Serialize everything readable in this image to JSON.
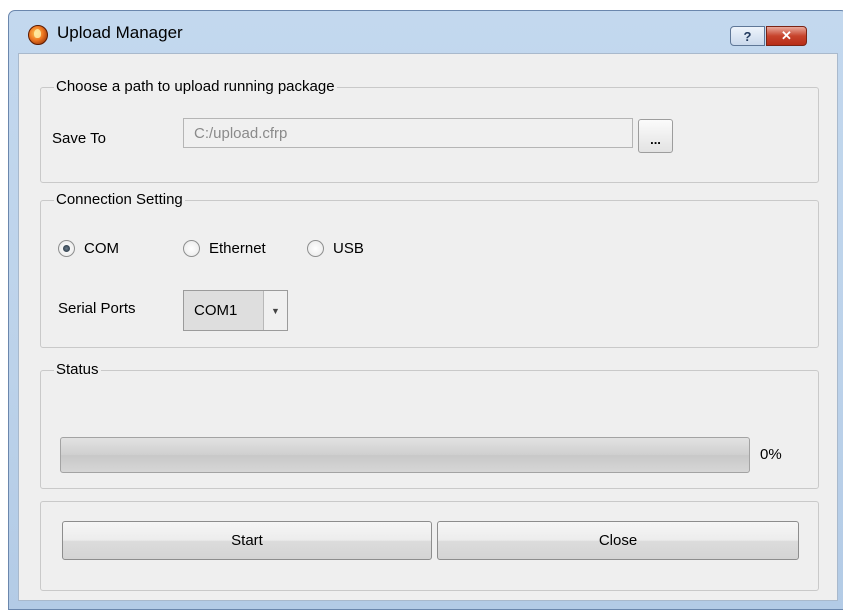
{
  "window": {
    "title": "Upload Manager",
    "help_label": "?",
    "close_label": "✕"
  },
  "path_group": {
    "legend": "Choose a path to upload running package",
    "save_to_label": "Save To",
    "path_value": "C:/upload.cfrp",
    "browse_label": "..."
  },
  "connection_group": {
    "legend": "Connection Setting",
    "options": [
      {
        "label": "COM",
        "checked": true
      },
      {
        "label": "Ethernet",
        "checked": false
      },
      {
        "label": "USB",
        "checked": false
      }
    ],
    "serial_ports_label": "Serial Ports",
    "serial_port_value": "COM1"
  },
  "status_group": {
    "legend": "Status",
    "progress_percent": 0,
    "progress_text": "0%"
  },
  "actions": {
    "start_label": "Start",
    "close_label": "Close"
  },
  "colors": {
    "titlebar": "#bcd2ea",
    "client_bg": "#efefef",
    "close_button": "#c7432c",
    "progress_fill": "#37b24d"
  }
}
